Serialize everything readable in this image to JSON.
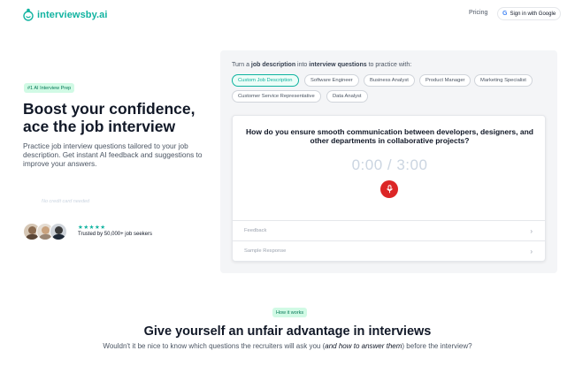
{
  "header": {
    "logo_text": "interviewsby.ai",
    "nav_pricing": "Pricing",
    "google_button": "Sign in with Google",
    "google_letter": "G"
  },
  "hero": {
    "badge": "#1 AI Interview Prep",
    "title_line1": "Boost your confidence,",
    "title_line2": "ace the job interview",
    "description": "Practice job interview questions tailored to your job description. Get instant AI feedback and suggestions to improve your answers.",
    "no_credit_card": "No credit card needed",
    "stars": "★★★★★",
    "trusted_text": "Trusted by 50,000+ job seekers"
  },
  "panel": {
    "intro_prefix": "Turn a ",
    "intro_bold1": "job description",
    "intro_mid": " into ",
    "intro_bold2": "interview questions",
    "intro_suffix": " to practice with:",
    "chips": [
      {
        "label": "Custom Job Description",
        "active": true
      },
      {
        "label": "Software Engineer",
        "active": false
      },
      {
        "label": "Business Analyst",
        "active": false
      },
      {
        "label": "Product Manager",
        "active": false
      },
      {
        "label": "Marketing Specialist",
        "active": false
      },
      {
        "label": "Customer Service Representative",
        "active": false
      },
      {
        "label": "Data Analyst",
        "active": false
      }
    ],
    "question": "How do you ensure smooth communication between developers, designers, and other departments in collaborative projects?",
    "timer": "0:00 / 3:00",
    "feedback_label": "Feedback",
    "sample_label": "Sample Response"
  },
  "how": {
    "badge": "How it works",
    "title": "Give yourself an unfair advantage in interviews",
    "sub_prefix": "Wouldn't it be nice to know which questions the recruiters will ask you (",
    "sub_italic": "and how to answer them",
    "sub_suffix": ") before the interview?"
  },
  "colors": {
    "accent": "#10b3a0",
    "record": "#dc2626",
    "badge_bg": "#d1fae5"
  },
  "icons": {
    "logo": "interview-logo-icon",
    "mic": "microphone-icon",
    "chevron": "chevron-right-icon",
    "google": "google-icon"
  }
}
